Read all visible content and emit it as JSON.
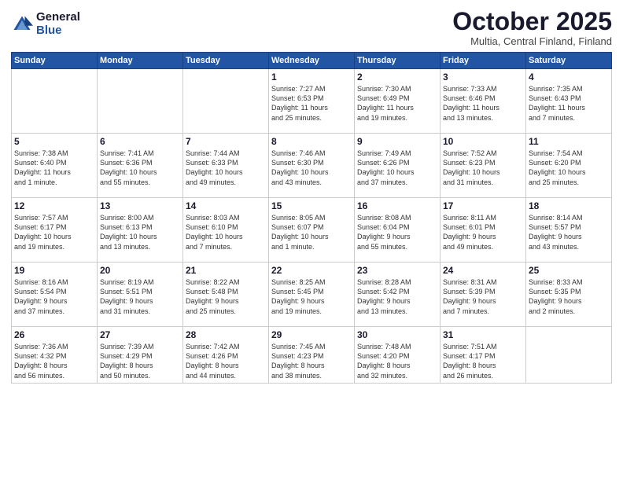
{
  "logo": {
    "general": "General",
    "blue": "Blue"
  },
  "title": "October 2025",
  "location": "Multia, Central Finland, Finland",
  "days_header": [
    "Sunday",
    "Monday",
    "Tuesday",
    "Wednesday",
    "Thursday",
    "Friday",
    "Saturday"
  ],
  "weeks": [
    [
      {
        "day": "",
        "info": ""
      },
      {
        "day": "",
        "info": ""
      },
      {
        "day": "",
        "info": ""
      },
      {
        "day": "1",
        "info": "Sunrise: 7:27 AM\nSunset: 6:53 PM\nDaylight: 11 hours\nand 25 minutes."
      },
      {
        "day": "2",
        "info": "Sunrise: 7:30 AM\nSunset: 6:49 PM\nDaylight: 11 hours\nand 19 minutes."
      },
      {
        "day": "3",
        "info": "Sunrise: 7:33 AM\nSunset: 6:46 PM\nDaylight: 11 hours\nand 13 minutes."
      },
      {
        "day": "4",
        "info": "Sunrise: 7:35 AM\nSunset: 6:43 PM\nDaylight: 11 hours\nand 7 minutes."
      }
    ],
    [
      {
        "day": "5",
        "info": "Sunrise: 7:38 AM\nSunset: 6:40 PM\nDaylight: 11 hours\nand 1 minute."
      },
      {
        "day": "6",
        "info": "Sunrise: 7:41 AM\nSunset: 6:36 PM\nDaylight: 10 hours\nand 55 minutes."
      },
      {
        "day": "7",
        "info": "Sunrise: 7:44 AM\nSunset: 6:33 PM\nDaylight: 10 hours\nand 49 minutes."
      },
      {
        "day": "8",
        "info": "Sunrise: 7:46 AM\nSunset: 6:30 PM\nDaylight: 10 hours\nand 43 minutes."
      },
      {
        "day": "9",
        "info": "Sunrise: 7:49 AM\nSunset: 6:26 PM\nDaylight: 10 hours\nand 37 minutes."
      },
      {
        "day": "10",
        "info": "Sunrise: 7:52 AM\nSunset: 6:23 PM\nDaylight: 10 hours\nand 31 minutes."
      },
      {
        "day": "11",
        "info": "Sunrise: 7:54 AM\nSunset: 6:20 PM\nDaylight: 10 hours\nand 25 minutes."
      }
    ],
    [
      {
        "day": "12",
        "info": "Sunrise: 7:57 AM\nSunset: 6:17 PM\nDaylight: 10 hours\nand 19 minutes."
      },
      {
        "day": "13",
        "info": "Sunrise: 8:00 AM\nSunset: 6:13 PM\nDaylight: 10 hours\nand 13 minutes."
      },
      {
        "day": "14",
        "info": "Sunrise: 8:03 AM\nSunset: 6:10 PM\nDaylight: 10 hours\nand 7 minutes."
      },
      {
        "day": "15",
        "info": "Sunrise: 8:05 AM\nSunset: 6:07 PM\nDaylight: 10 hours\nand 1 minute."
      },
      {
        "day": "16",
        "info": "Sunrise: 8:08 AM\nSunset: 6:04 PM\nDaylight: 9 hours\nand 55 minutes."
      },
      {
        "day": "17",
        "info": "Sunrise: 8:11 AM\nSunset: 6:01 PM\nDaylight: 9 hours\nand 49 minutes."
      },
      {
        "day": "18",
        "info": "Sunrise: 8:14 AM\nSunset: 5:57 PM\nDaylight: 9 hours\nand 43 minutes."
      }
    ],
    [
      {
        "day": "19",
        "info": "Sunrise: 8:16 AM\nSunset: 5:54 PM\nDaylight: 9 hours\nand 37 minutes."
      },
      {
        "day": "20",
        "info": "Sunrise: 8:19 AM\nSunset: 5:51 PM\nDaylight: 9 hours\nand 31 minutes."
      },
      {
        "day": "21",
        "info": "Sunrise: 8:22 AM\nSunset: 5:48 PM\nDaylight: 9 hours\nand 25 minutes."
      },
      {
        "day": "22",
        "info": "Sunrise: 8:25 AM\nSunset: 5:45 PM\nDaylight: 9 hours\nand 19 minutes."
      },
      {
        "day": "23",
        "info": "Sunrise: 8:28 AM\nSunset: 5:42 PM\nDaylight: 9 hours\nand 13 minutes."
      },
      {
        "day": "24",
        "info": "Sunrise: 8:31 AM\nSunset: 5:39 PM\nDaylight: 9 hours\nand 7 minutes."
      },
      {
        "day": "25",
        "info": "Sunrise: 8:33 AM\nSunset: 5:35 PM\nDaylight: 9 hours\nand 2 minutes."
      }
    ],
    [
      {
        "day": "26",
        "info": "Sunrise: 7:36 AM\nSunset: 4:32 PM\nDaylight: 8 hours\nand 56 minutes."
      },
      {
        "day": "27",
        "info": "Sunrise: 7:39 AM\nSunset: 4:29 PM\nDaylight: 8 hours\nand 50 minutes."
      },
      {
        "day": "28",
        "info": "Sunrise: 7:42 AM\nSunset: 4:26 PM\nDaylight: 8 hours\nand 44 minutes."
      },
      {
        "day": "29",
        "info": "Sunrise: 7:45 AM\nSunset: 4:23 PM\nDaylight: 8 hours\nand 38 minutes."
      },
      {
        "day": "30",
        "info": "Sunrise: 7:48 AM\nSunset: 4:20 PM\nDaylight: 8 hours\nand 32 minutes."
      },
      {
        "day": "31",
        "info": "Sunrise: 7:51 AM\nSunset: 4:17 PM\nDaylight: 8 hours\nand 26 minutes."
      },
      {
        "day": "",
        "info": ""
      }
    ]
  ]
}
